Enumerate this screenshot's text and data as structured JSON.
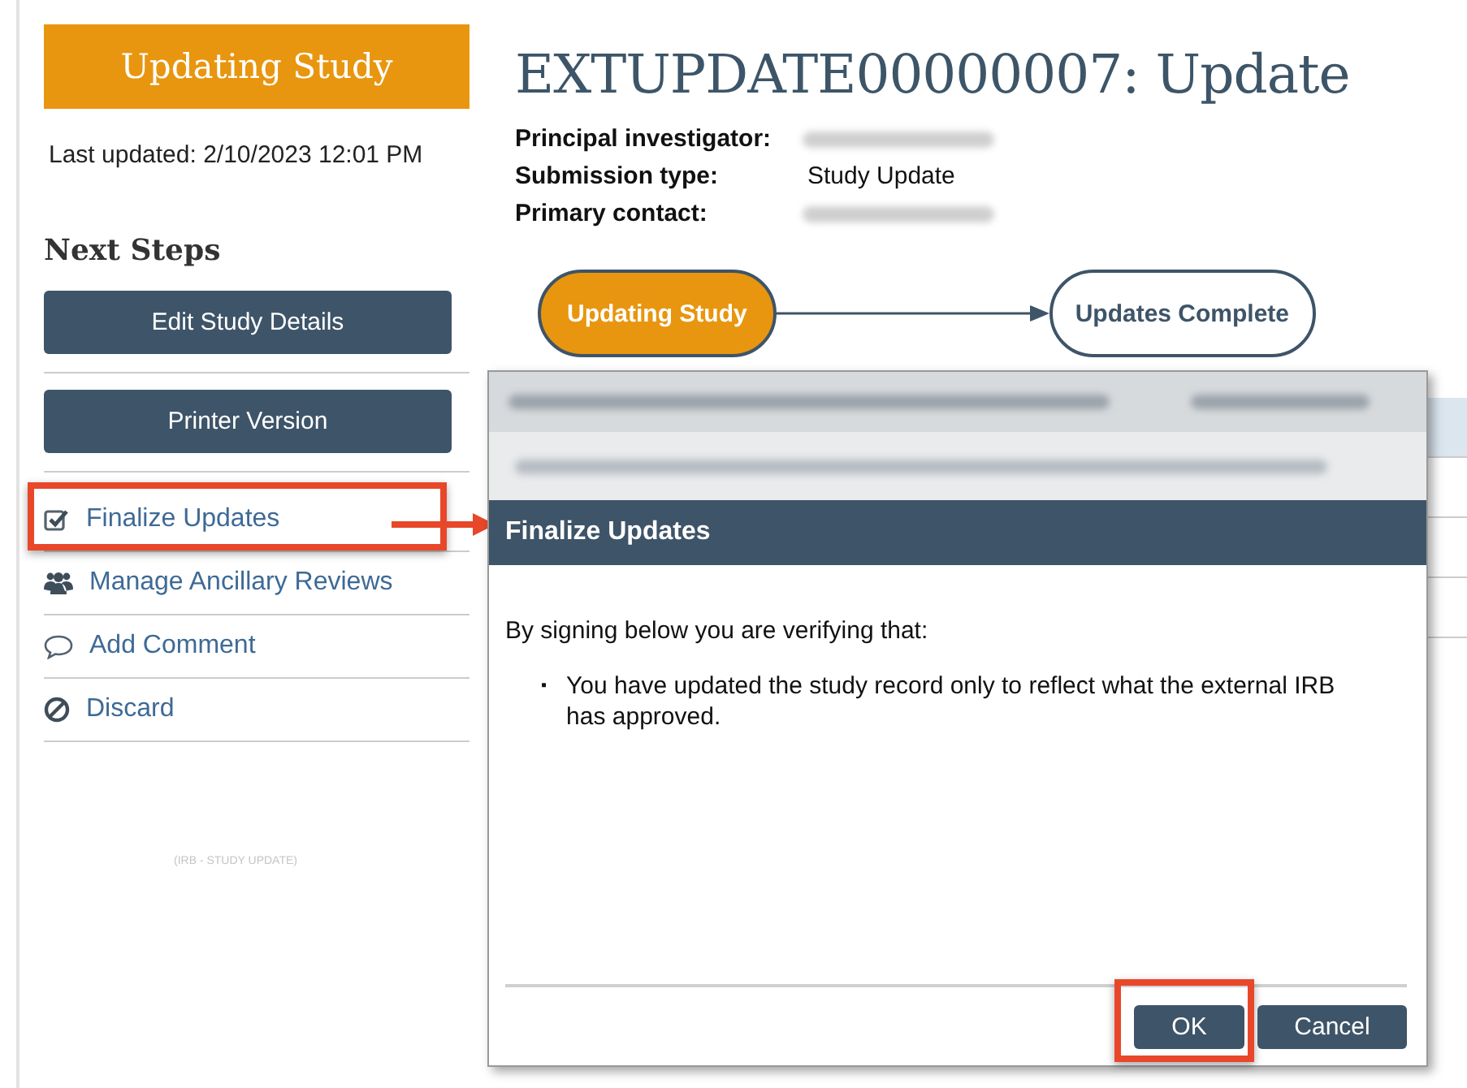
{
  "sidebar": {
    "status": "Updating Study",
    "last_updated": "Last updated: 2/10/2023 12:01 PM",
    "next_steps_title": "Next Steps",
    "buttons": [
      "Edit Study Details",
      "Printer Version"
    ],
    "actions": [
      {
        "label": "Finalize Updates",
        "kind": "check",
        "highlighted": true
      },
      {
        "label": "Manage Ancillary Reviews",
        "kind": "people",
        "highlighted": false
      },
      {
        "label": "Add Comment",
        "kind": "comment",
        "highlighted": false
      },
      {
        "label": "Discard",
        "kind": "discard",
        "highlighted": false
      }
    ],
    "footer": "(IRB - STUDY UPDATE)"
  },
  "main": {
    "title": "EXTUPDATE00000007: Update",
    "details": [
      {
        "label": "Principal investigator:",
        "redacted": true
      },
      {
        "label": "Submission type:",
        "value": "Study Update"
      },
      {
        "label": "Primary contact:",
        "redacted": true
      }
    ],
    "workflow": [
      {
        "label": "Updating Study",
        "selected": true
      },
      {
        "label": "Updates Complete",
        "selected": false
      }
    ]
  },
  "dialog": {
    "title": "Finalize Updates",
    "intro": "By signing below you are verifying that:",
    "bullets": [
      {
        "marker": "▪",
        "text": "You have updated the study record only to reflect what the external IRB has approved."
      }
    ],
    "buttons": [
      {
        "label": "OK",
        "highlighted": true
      },
      {
        "label": "Cancel",
        "highlighted": false
      }
    ]
  }
}
